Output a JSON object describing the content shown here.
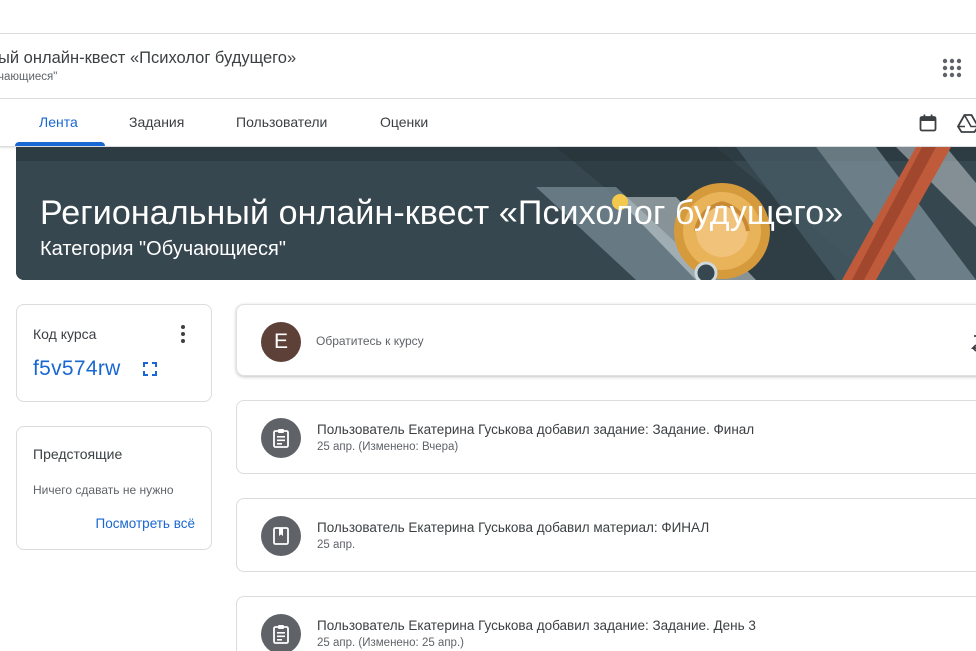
{
  "header": {
    "class_title": "ый онлайн-квест «Психолог будущего»",
    "class_subtitle": "чающиеся\"",
    "apps_icon": "apps-grid-icon"
  },
  "tabs": [
    {
      "label": "Лента",
      "active": true
    },
    {
      "label": "Задания",
      "active": false
    },
    {
      "label": "Пользователи",
      "active": false
    },
    {
      "label": "Оценки",
      "active": false
    }
  ],
  "toolbar_icons": [
    "calendar-icon",
    "drive-icon"
  ],
  "banner": {
    "title": "Региональный онлайн-квест «Психолог будущего»",
    "subtitle": "Категория \"Обучающиеся\"",
    "background_color": "#37474f"
  },
  "class_code": {
    "label": "Код курса",
    "value": "f5v574rw"
  },
  "upcoming": {
    "title": "Предстоящие",
    "empty_text": "Ничего сдавать не нужно",
    "link": "Посмотреть всё"
  },
  "compose": {
    "avatar_letter": "E",
    "placeholder": "Обратитесь к курсу"
  },
  "posts": [
    {
      "icon": "assignment-icon",
      "title": "Пользователь Екатерина Гуськова добавил задание: Задание. Финал",
      "meta": "25 апр. (Изменено: Вчера)"
    },
    {
      "icon": "material-icon",
      "title": "Пользователь Екатерина Гуськова добавил материал: ФИНАЛ",
      "meta": "25 апр."
    },
    {
      "icon": "assignment-icon",
      "title": "Пользователь Екатерина Гуськова добавил задание: Задание. День 3",
      "meta": "25 апр. (Изменено: 25 апр.)"
    }
  ],
  "colors": {
    "accent": "#1967d2",
    "text": "#3c4043",
    "muted": "#5f6368",
    "avatar": "#5d4037"
  }
}
